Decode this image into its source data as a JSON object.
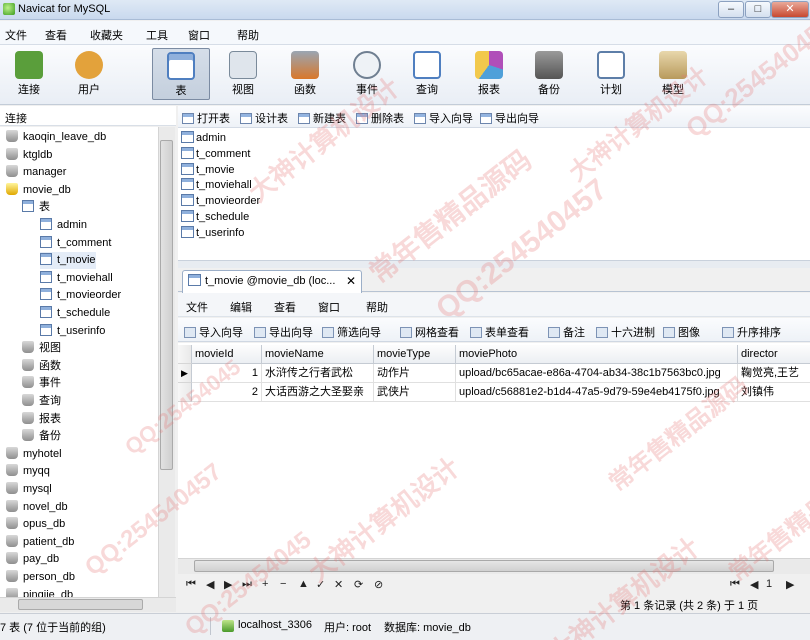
{
  "window": {
    "title": "Navicat for MySQL",
    "minimize": "–",
    "maximize": "□",
    "close": "✕"
  },
  "menu": [
    "文件",
    "查看",
    "收藏夹",
    "工具",
    "窗口",
    "帮助"
  ],
  "toolbar": [
    {
      "label": "连接",
      "icon": "connection-icon",
      "color": "#5a9e3b"
    },
    {
      "label": "用户",
      "icon": "user-icon",
      "color": "#e3a23b"
    },
    {
      "label": "表",
      "icon": "table-icon",
      "color": "#4f7fc0"
    },
    {
      "label": "视图",
      "icon": "view-icon",
      "color": "#7a8a9a"
    },
    {
      "label": "函数",
      "icon": "function-icon",
      "color": "#d9772a"
    },
    {
      "label": "事件",
      "icon": "event-icon",
      "color": "#6f7f91"
    },
    {
      "label": "查询",
      "icon": "query-icon",
      "color": "#4f7fc0"
    },
    {
      "label": "报表",
      "icon": "report-icon",
      "color": "#b04fb9"
    },
    {
      "label": "备份",
      "icon": "backup-icon",
      "color": "#6f6f6f"
    },
    {
      "label": "计划",
      "icon": "schedule-icon",
      "color": "#5d7ea8"
    },
    {
      "label": "模型",
      "icon": "model-icon",
      "color": "#b89a5c"
    }
  ],
  "left_panel": {
    "header": "连接",
    "tree": [
      {
        "label": "kaoqin_leave_db",
        "kind": "db"
      },
      {
        "label": "ktgldb",
        "kind": "db"
      },
      {
        "label": "manager",
        "kind": "db"
      },
      {
        "label": "movie_db",
        "kind": "db-open"
      },
      {
        "label": "表",
        "kind": "tables"
      },
      {
        "label": "admin",
        "kind": "table"
      },
      {
        "label": "t_comment",
        "kind": "table"
      },
      {
        "label": "t_movie",
        "kind": "table"
      },
      {
        "label": "t_moviehall",
        "kind": "table"
      },
      {
        "label": "t_movieorder",
        "kind": "table"
      },
      {
        "label": "t_schedule",
        "kind": "table"
      },
      {
        "label": "t_userinfo",
        "kind": "table"
      },
      {
        "label": "视图",
        "kind": "view"
      },
      {
        "label": "函数",
        "kind": "func"
      },
      {
        "label": "事件",
        "kind": "event"
      },
      {
        "label": "查询",
        "kind": "query"
      },
      {
        "label": "报表",
        "kind": "report"
      },
      {
        "label": "备份",
        "kind": "backup"
      },
      {
        "label": "myhotel",
        "kind": "db"
      },
      {
        "label": "myqq",
        "kind": "db"
      },
      {
        "label": "mysql",
        "kind": "db"
      },
      {
        "label": "novel_db",
        "kind": "db"
      },
      {
        "label": "opus_db",
        "kind": "db"
      },
      {
        "label": "patient_db",
        "kind": "db"
      },
      {
        "label": "pay_db",
        "kind": "db"
      },
      {
        "label": "person_db",
        "kind": "db"
      },
      {
        "label": "pinqiie_db",
        "kind": "db"
      }
    ]
  },
  "object_toolbar": [
    "打开表",
    "设计表",
    "新建表",
    "删除表",
    "导入向导",
    "导出向导"
  ],
  "object_list": [
    "admin",
    "t_comment",
    "t_movie",
    "t_moviehall",
    "t_movieorder",
    "t_schedule",
    "t_userinfo"
  ],
  "tab": {
    "title": "t_movie @movie_db (loc...",
    "close": "✕"
  },
  "tab_menu": [
    "文件",
    "编辑",
    "查看",
    "窗口",
    "帮助"
  ],
  "tab_tools": [
    "导入向导",
    "导出向导",
    "筛选向导",
    "网格查看",
    "表单查看",
    "备注",
    "十六进制",
    "图像",
    "升序排序"
  ],
  "grid": {
    "columns": [
      "movieId",
      "movieName",
      "movieType",
      "moviePhoto",
      "director"
    ],
    "rows": [
      [
        "1",
        "水浒传之行者武松",
        "动作片",
        "upload/bc65acae-e86a-4704-ab34-38c1b7563bc0.jpg",
        "鞠觉亮,王艺"
      ],
      [
        "2",
        "大话西游之大圣娶亲",
        "武侠片",
        "upload/c56881e2-b1d4-47a5-9d79-59e4eb4175f0.jpg",
        "刘镇伟"
      ]
    ]
  },
  "nav": [
    "⏮",
    "◀",
    "▶",
    "⏭",
    "+",
    "−",
    "▲",
    "✓",
    "✕",
    "⟳",
    "⊘"
  ],
  "record_status": "第 1 条记录 (共 2 条) 于 1 页",
  "page_nav": [
    "⏮",
    "◀",
    "1",
    "▶"
  ],
  "statusbar": {
    "left": "7 表 (7 位于当前的组)",
    "host": "localhost_3306",
    "user": "用户: root",
    "db": "数据库: movie_db"
  },
  "watermarks": [
    "QQ:25454045",
    "大神计算机设计",
    "常年售精品源码",
    "QQ:254540457",
    "大神计算机设计",
    "常年售精品源码",
    "QQ:254540457",
    "大神计算机设计",
    "QQ:254540457",
    "QQ:25454045",
    "大神计算机设计",
    "常年售精品源码"
  ]
}
